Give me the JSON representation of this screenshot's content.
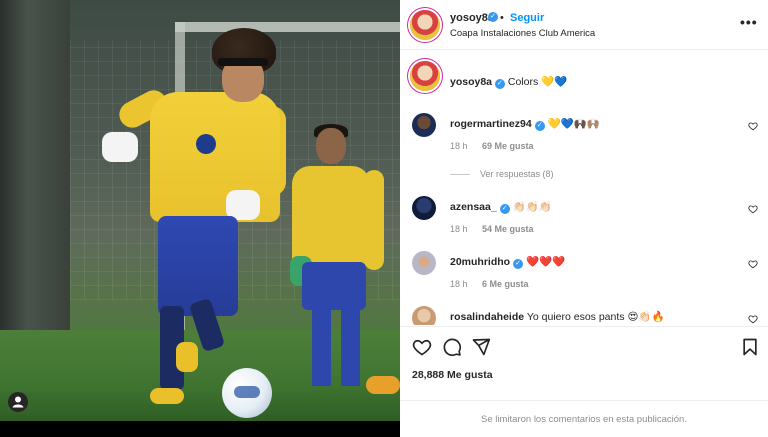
{
  "post": {
    "username": "yosoy8a",
    "follow_label": "Seguir",
    "separator": "•",
    "location": "Coapa Instalaciones Club America",
    "more": "•••",
    "caption": {
      "username": "yosoy8a",
      "text": "Colors 💛💙"
    },
    "likes_total": "28,888 Me gusta",
    "time_ago": "",
    "comments_limited": "Se limitaron los comentarios en esta publicación."
  },
  "comments": [
    {
      "username": "rogermartinez94",
      "verified": true,
      "text": "💛💙🙌🏿🙌🏽",
      "time": "18 h",
      "likes": "69 Me gusta"
    },
    {
      "username": "azensaa_",
      "verified": true,
      "text": "👏🏻👏🏻👏🏻",
      "time": "18 h",
      "likes": "54 Me gusta"
    },
    {
      "username": "20muhridho",
      "verified": true,
      "text": "❤️❤️❤️",
      "time": "18 h",
      "likes": "6 Me gusta"
    },
    {
      "username": "rosalindaheide",
      "verified": false,
      "text": "Yo quiero esos pants 😍👏🏻🔥",
      "time": "",
      "likes": ""
    }
  ],
  "view_replies": "Ver respuestas (8)",
  "icons": {
    "verified": "verified-badge-icon",
    "like": "heart-icon",
    "comment": "comment-icon",
    "share": "paper-plane-icon",
    "save": "bookmark-icon",
    "more": "more-options-icon",
    "user_tag": "user-tag-icon"
  },
  "colors": {
    "follow_blue": "#0095f6",
    "verified_blue": "#3897f0",
    "meta_gray": "#8e8e8e",
    "text": "#262626"
  }
}
